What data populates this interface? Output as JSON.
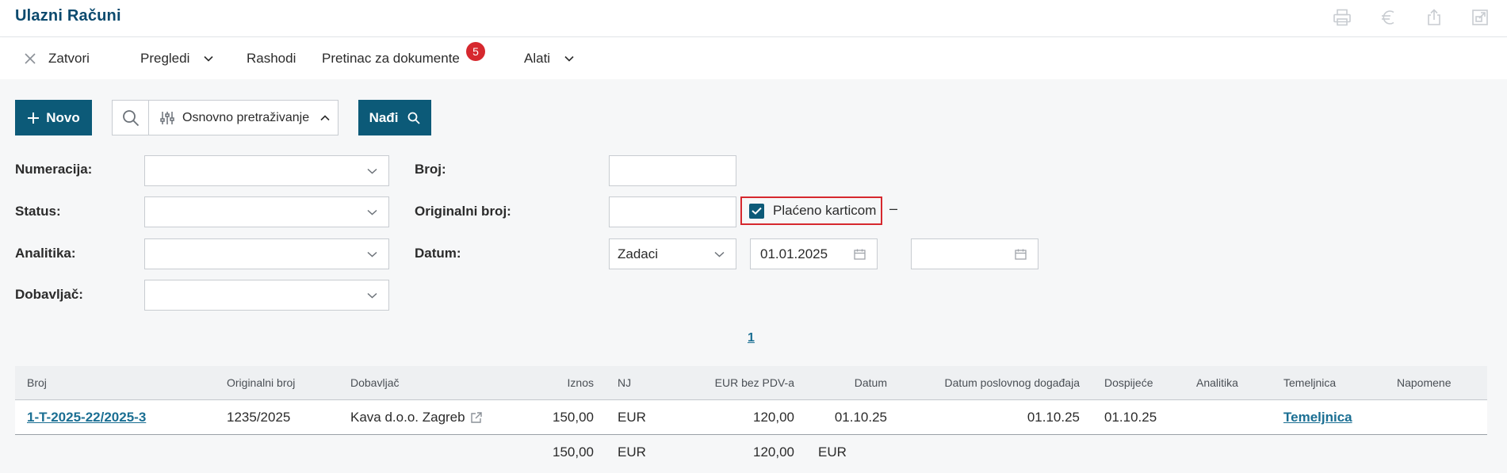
{
  "header": {
    "title": "Ulazni Računi",
    "icons": [
      "print-icon",
      "euro-icon",
      "share-icon",
      "external-window-icon"
    ]
  },
  "toolbar": {
    "close_label": "Zatvori",
    "views_label": "Pregledi",
    "expenses_label": "Rashodi",
    "documents_label": "Pretinac za dokumente",
    "documents_badge": "5",
    "tools_label": "Alati"
  },
  "actions": {
    "new_label": "Novo",
    "search_mode_label": "Osnovno pretraživanje",
    "find_label": "Nađi"
  },
  "filters": {
    "numeracija_label": "Numeracija:",
    "numeracija_value": "",
    "status_label": "Status:",
    "status_value": "",
    "analitika_label": "Analitika:",
    "analitika_value": "",
    "dobavljac_label": "Dobavljač:",
    "dobavljac_value": "",
    "broj_label": "Broj:",
    "broj_value": "",
    "originalni_broj_label": "Originalni broj:",
    "originalni_broj_value": "",
    "placeno_karticom_label": "Plaćeno karticom",
    "placeno_karticom_checked": true,
    "datum_label": "Datum:",
    "datum_type_value": "Zadaci",
    "date_from": "01.01.2025",
    "date_separator": "–",
    "date_to": ""
  },
  "pagination": {
    "current_page": "1"
  },
  "table": {
    "columns": [
      "Broj",
      "Originalni broj",
      "Dobavljač",
      "Iznos",
      "NJ",
      "EUR bez PDV-a",
      "Datum",
      "Datum poslovnog događaja",
      "Dospijeće",
      "Analitika",
      "Temeljnica",
      "Napomene"
    ],
    "rows": [
      {
        "broj": "1-T-2025-22/2025-3",
        "originalni_broj": "1235/2025",
        "dobavljac": "Kava d.o.o. Zagreb",
        "iznos": "150,00",
        "nj": "EUR",
        "eur_bez_pdv": "120,00",
        "datum": "01.10.25",
        "datum_poslovnog_dogadaja": "01.10.25",
        "dospijece": "01.10.25",
        "analitika": "",
        "temeljnica": "Temeljnica",
        "napomene": ""
      }
    ],
    "totals": {
      "iznos": "150,00",
      "nj": "EUR",
      "eur_bez_pdv": "120,00",
      "currency": "EUR"
    }
  },
  "colors": {
    "primary": "#0c5a78",
    "title": "#0c4a6e",
    "link": "#1b6f93",
    "badge": "#d6282e",
    "highlight": "#d6282e"
  }
}
